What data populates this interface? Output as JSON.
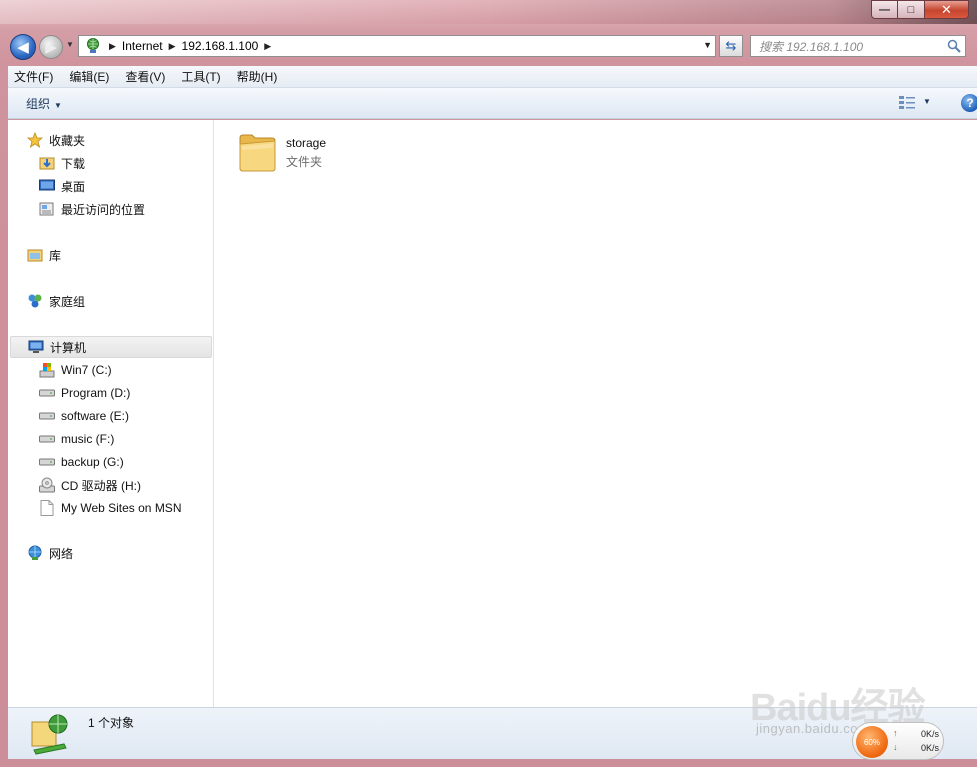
{
  "window": {
    "minimize_glyph": "—",
    "maximize_glyph": "□",
    "close_glyph": "✕"
  },
  "address_bar": {
    "crumbs": [
      "Internet",
      "192.168.1.100"
    ],
    "search_placeholder": "搜索 192.168.1.100",
    "icon": "network-globe-icon"
  },
  "menu": {
    "items": [
      "文件(F)",
      "编辑(E)",
      "查看(V)",
      "工具(T)",
      "帮助(H)"
    ]
  },
  "toolbar": {
    "organize_label": "组织",
    "help_label": "?"
  },
  "sidebar": {
    "favorites": {
      "label": "收藏夹",
      "items": [
        {
          "label": "下载",
          "icon": "download-folder-icon"
        },
        {
          "label": "桌面",
          "icon": "desktop-icon"
        },
        {
          "label": "最近访问的位置",
          "icon": "recent-places-icon"
        }
      ]
    },
    "libraries": {
      "label": "库"
    },
    "homegroup": {
      "label": "家庭组"
    },
    "computer": {
      "label": "计算机",
      "items": [
        {
          "label": "Win7 (C:)",
          "icon": "system-drive-icon"
        },
        {
          "label": "Program (D:)",
          "icon": "drive-icon"
        },
        {
          "label": "software (E:)",
          "icon": "drive-icon"
        },
        {
          "label": "music (F:)",
          "icon": "drive-icon"
        },
        {
          "label": "backup (G:)",
          "icon": "drive-icon"
        },
        {
          "label": "CD 驱动器 (H:)",
          "icon": "cd-drive-icon"
        },
        {
          "label": "My Web Sites on MSN",
          "icon": "document-icon"
        }
      ]
    },
    "network": {
      "label": "网络"
    }
  },
  "content": {
    "items": [
      {
        "name": "storage",
        "type": "文件夹",
        "icon": "folder-icon"
      }
    ]
  },
  "status": {
    "text": "1 个对象"
  },
  "watermark": {
    "top": "Baidu经验",
    "bottom": "jingyan.baidu.com"
  },
  "speed_widget": {
    "percent": "60%",
    "up": "0K/s",
    "down": "0K/s"
  },
  "colors": {
    "accent": "#2b68c4",
    "frame": "#c98a8f",
    "toolbar": "#e9f0f8"
  }
}
